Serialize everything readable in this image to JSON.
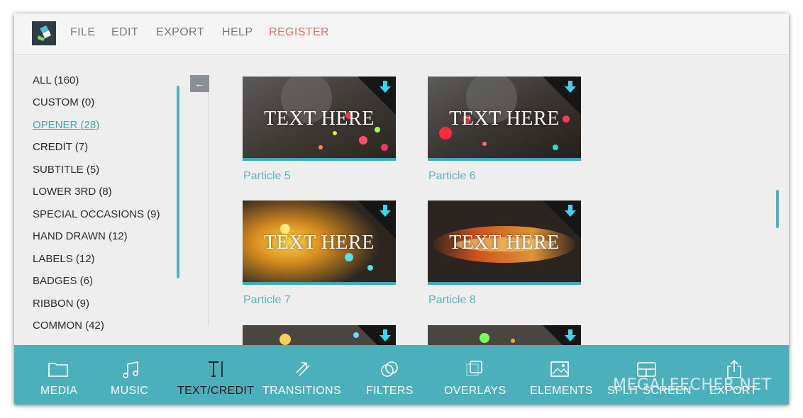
{
  "menu": {
    "file": "FILE",
    "edit": "EDIT",
    "export": "EXPORT",
    "help": "HELP",
    "register": "REGISTER"
  },
  "sidebar": {
    "categories": [
      {
        "label": "ALL (160)",
        "active": false
      },
      {
        "label": "CUSTOM (0)",
        "active": false
      },
      {
        "label": "OPENER (28)",
        "active": true
      },
      {
        "label": "CREDIT (7)",
        "active": false
      },
      {
        "label": "SUBTITLE (5)",
        "active": false
      },
      {
        "label": "LOWER 3RD (8)",
        "active": false
      },
      {
        "label": "SPECIAL OCCASIONS (9)",
        "active": false
      },
      {
        "label": "HAND DRAWN (12)",
        "active": false
      },
      {
        "label": "LABELS (12)",
        "active": false
      },
      {
        "label": "BADGES (6)",
        "active": false
      },
      {
        "label": "RIBBON (9)",
        "active": false
      },
      {
        "label": "COMMON (42)",
        "active": false
      }
    ],
    "collapse_icon": "arrow-left-icon"
  },
  "grid": {
    "thumb_text": "TEXT HERE",
    "tiles": [
      {
        "label": "Particle 5"
      },
      {
        "label": "Particle 6"
      },
      {
        "label": "Particle 7"
      },
      {
        "label": "Particle 8"
      }
    ]
  },
  "toolbar": {
    "items": [
      {
        "label": "MEDIA",
        "icon": "folder-icon"
      },
      {
        "label": "MUSIC",
        "icon": "music-note-icon"
      },
      {
        "label": "TEXT/CREDIT",
        "icon": "text-icon",
        "active": true
      },
      {
        "label": "TRANSITIONS",
        "icon": "transitions-icon"
      },
      {
        "label": "FILTERS",
        "icon": "filters-icon"
      },
      {
        "label": "OVERLAYS",
        "icon": "overlays-icon"
      },
      {
        "label": "ELEMENTS",
        "icon": "image-icon"
      },
      {
        "label": "SPLIT SCREEN",
        "icon": "split-screen-icon"
      },
      {
        "label": "EXPORT",
        "icon": "share-icon"
      }
    ]
  },
  "watermark": "MEGALEECHER.NET",
  "colors": {
    "accent": "#4cb0bc",
    "register": "#ea7070",
    "active_category": "#3fa9b7"
  }
}
